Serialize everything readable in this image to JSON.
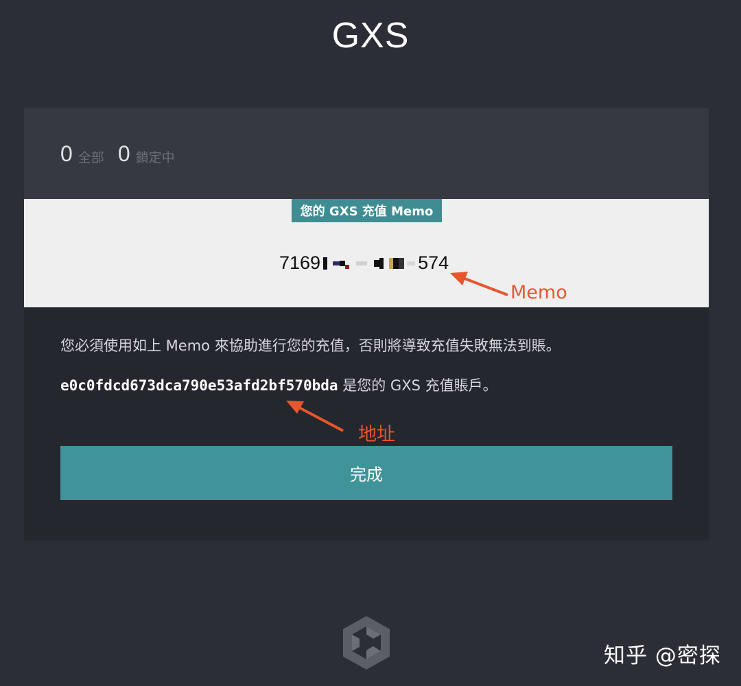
{
  "header": {
    "title": "GXS"
  },
  "balance": {
    "total_value": "0",
    "total_label": "全部",
    "locked_value": "0",
    "locked_label": "鎖定中"
  },
  "memo": {
    "badge": "您的 GXS 充值 Memo",
    "value_prefix": "7169",
    "value_suffix": "574"
  },
  "instructions": {
    "notice": "您必須使用如上 Memo 來協助進行您的充值，否則將導致充值失敗無法到賬。",
    "address": "e0c0fdcd673dca790e53afd2bf570bda",
    "address_suffix": " 是您的 GXS 充值賬戶。"
  },
  "actions": {
    "done_label": "完成"
  },
  "annotations": {
    "memo_label": "Memo",
    "address_label": "地址",
    "color": "#e8562d"
  },
  "footer": {
    "logo_icon": "gxs-logo-icon",
    "watermark": "知乎 @密探"
  }
}
